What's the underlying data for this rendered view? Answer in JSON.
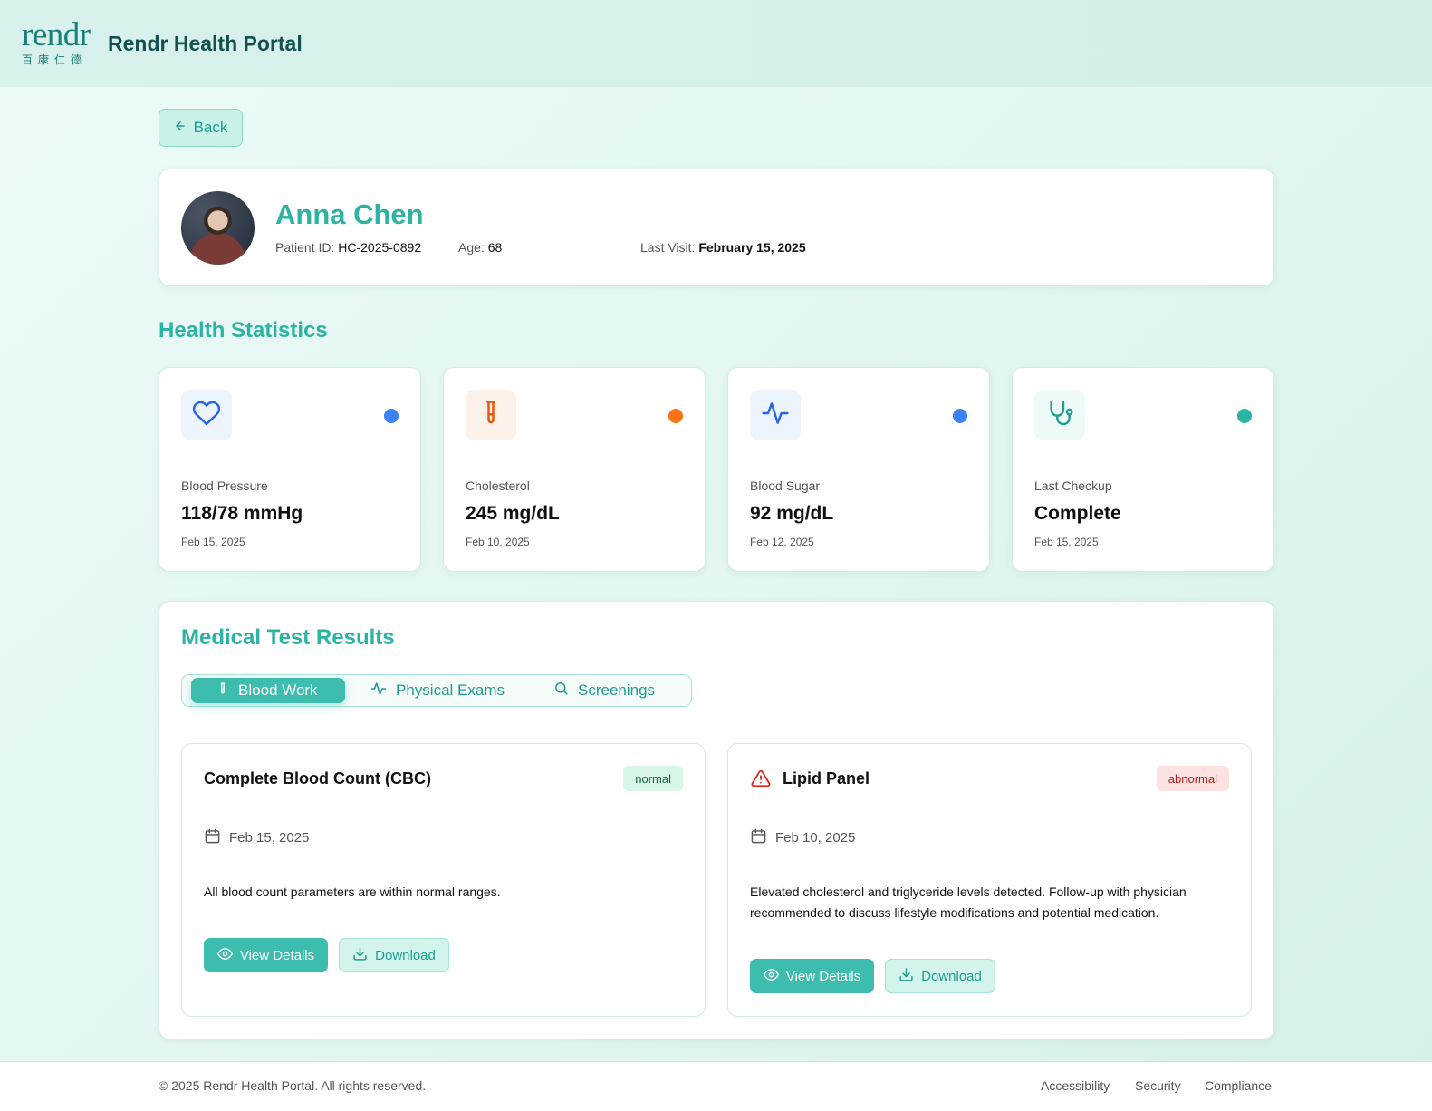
{
  "header": {
    "logo_text": "rendr",
    "logo_subtext": "百康仁德",
    "title": "Rendr Health Portal"
  },
  "back_label": "Back",
  "patient": {
    "name": "Anna Chen",
    "id_label": "Patient ID:",
    "id_value": "HC-2025-0892",
    "age_label": "Age:",
    "age_value": "68",
    "last_visit_label": "Last Visit:",
    "last_visit_value": "February 15, 2025"
  },
  "stats_section": {
    "title": "Health Statistics",
    "items": [
      {
        "label": "Blood Pressure",
        "value": "118/78 mmHg",
        "date": "Feb 15, 2025",
        "icon": "heart-icon",
        "accent": "#2563eb",
        "icon_bg": "#eef4fd",
        "dot": "#3b82f6"
      },
      {
        "label": "Cholesterol",
        "value": "245 mg/dL",
        "date": "Feb 10, 2025",
        "icon": "test-tube-icon",
        "accent": "#ea580c",
        "icon_bg": "#fdf2ea",
        "dot": "#f97316"
      },
      {
        "label": "Blood Sugar",
        "value": "92 mg/dL",
        "date": "Feb 12, 2025",
        "icon": "activity-icon",
        "accent": "#2563eb",
        "icon_bg": "#eef4fd",
        "dot": "#3b82f6"
      },
      {
        "label": "Last Checkup",
        "value": "Complete",
        "date": "Feb 15, 2025",
        "icon": "stethoscope-icon",
        "accent": "#1f9d8f",
        "icon_bg": "#eefaf7",
        "dot": "#2bb3a3"
      }
    ]
  },
  "results_section": {
    "title": "Medical Test Results",
    "tabs": [
      {
        "label": "Blood Work",
        "icon": "test-tube-icon",
        "active": true
      },
      {
        "label": "Physical Exams",
        "icon": "activity-icon",
        "active": false
      },
      {
        "label": "Screenings",
        "icon": "search-icon",
        "active": false
      }
    ],
    "results": [
      {
        "title": "Complete Blood Count (CBC)",
        "status": "normal",
        "date": "Feb 15, 2025",
        "description": "All blood count parameters are within normal ranges.",
        "view_label": "View Details",
        "download_label": "Download"
      },
      {
        "title": "Lipid Panel",
        "status": "abnormal",
        "date": "Feb 10, 2025",
        "description": "Elevated cholesterol and triglyceride levels detected. Follow-up with physician recommended to discuss lifestyle modifications and potential medication.",
        "view_label": "View Details",
        "download_label": "Download",
        "icon": "warning-icon"
      }
    ]
  },
  "footer": {
    "copyright": "© 2025 Rendr Health Portal. All rights reserved.",
    "links": [
      "Accessibility",
      "Security",
      "Compliance"
    ]
  },
  "colors": {
    "accent": "#2bb3a3",
    "primary_button": "#3dbdad",
    "header_text": "#12514f"
  }
}
